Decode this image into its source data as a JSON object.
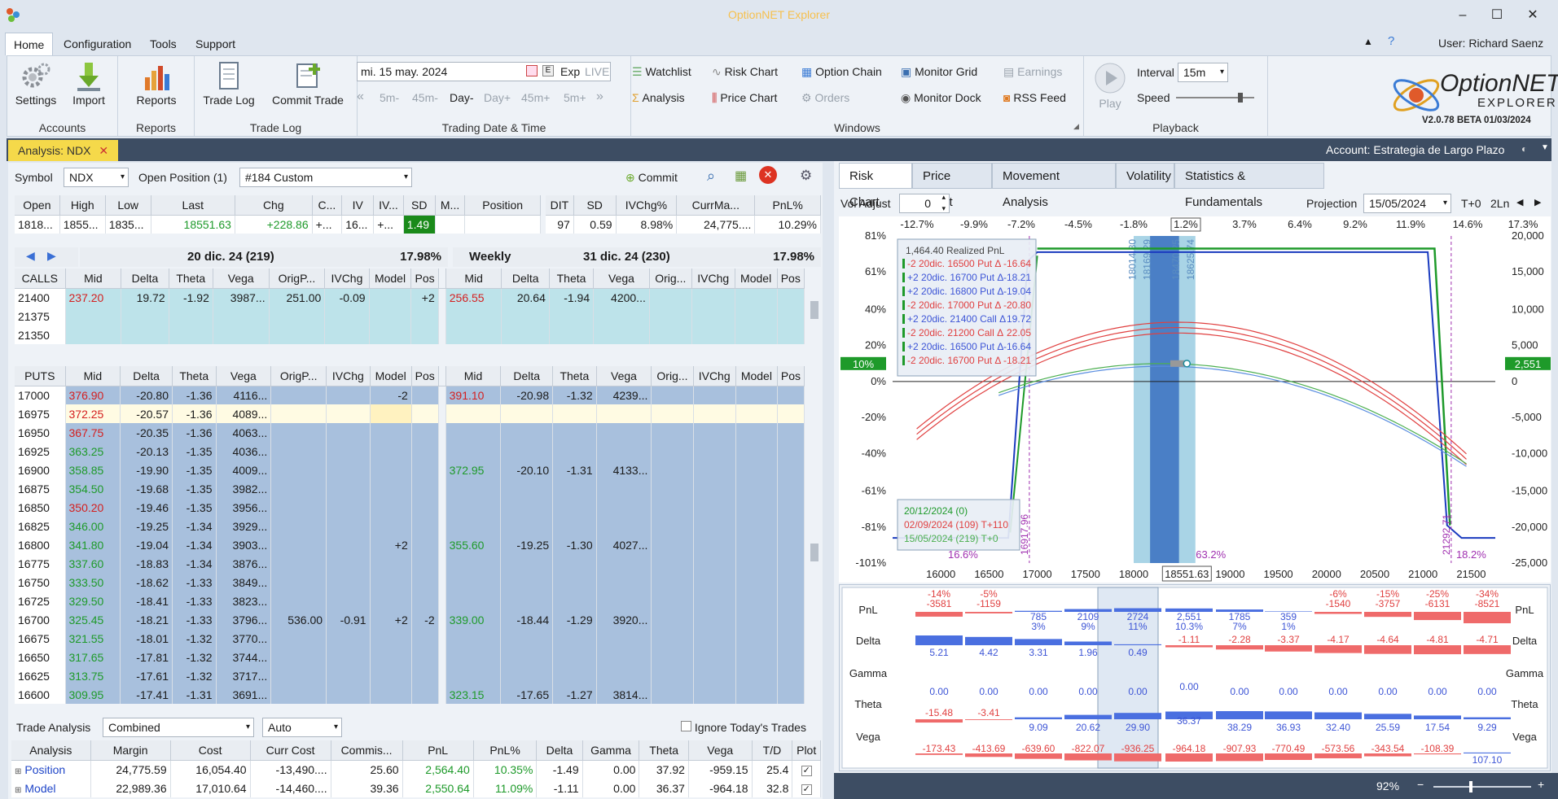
{
  "app": {
    "title": "OptionNET Explorer",
    "user": "User: Richard Saenz",
    "version": "V2.0.78 BETA 01/03/2024",
    "logo_text": "OptionNET",
    "logo_sub": "EXPLORER"
  },
  "menu": [
    "Home",
    "Configuration",
    "Tools",
    "Support"
  ],
  "ribbon": {
    "accounts": {
      "label": "Accounts",
      "settings": "Settings",
      "import": "Import"
    },
    "reports": {
      "label": "Reports",
      "reports": "Reports"
    },
    "tradelog": {
      "label": "Trade Log",
      "tradelog": "Trade Log",
      "commit": "Commit Trade"
    },
    "tradingdate": {
      "label": "Trading Date & Time",
      "date": "mi. 15 may. 2024",
      "exp": "Exp",
      "live": "LIVE",
      "steps": [
        "5m-",
        "45m-",
        "Day-",
        "Day+",
        "45m+",
        "5m+"
      ]
    },
    "windows": {
      "label": "Windows",
      "items": [
        "Watchlist",
        "Risk Chart",
        "Option Chain",
        "Monitor Grid",
        "Earnings",
        "Analysis",
        "Price Chart",
        "Orders",
        "Monitor Dock",
        "RSS Feed"
      ]
    },
    "playback": {
      "label": "Playback",
      "play": "Play",
      "interval_label": "Interval",
      "interval": "15m",
      "speed_label": "Speed"
    }
  },
  "tabs": {
    "analysis": "Analysis: NDX",
    "account": "Account: Estrategia de Largo Plazo"
  },
  "symbol_bar": {
    "symbol_label": "Symbol",
    "symbol": "NDX",
    "open_pos_label": "Open Position (1)",
    "position": "#184 Custom",
    "commit": "Commit"
  },
  "quote": {
    "headers": [
      "Open",
      "High",
      "Low",
      "Last",
      "Chg",
      "C...",
      "IV",
      "IV...",
      "SD",
      "M...",
      "Position"
    ],
    "values": [
      "1818...",
      "1855...",
      "1835...",
      "18551.63",
      "+228.86",
      "+...",
      "16...",
      "+...",
      "1.49",
      "",
      ""
    ],
    "headers2": [
      "DIT",
      "SD",
      "IVChg%",
      "CurrMa...",
      "PnL%"
    ],
    "values2": [
      "97",
      "0.59",
      "8.98%",
      "24,775....",
      "10.29%"
    ]
  },
  "chain": {
    "exp1": {
      "date": "20 dic. 24 (219)",
      "iv": "17.98%"
    },
    "exp2": {
      "name": "Weekly",
      "date": "31 dic. 24 (230)",
      "iv": "17.98%"
    },
    "cols1": [
      "Mid",
      "Delta",
      "Theta",
      "Vega",
      "OrigP...",
      "IVChg",
      "Model",
      "Pos"
    ],
    "cols2": [
      "Mid",
      "Delta",
      "Theta",
      "Vega",
      "Orig...",
      "IVChg",
      "Model",
      "Pos"
    ],
    "calls_label": "CALLS",
    "calls": [
      {
        "strike": "21400",
        "mid": "237.20",
        "delta": "19.72",
        "theta": "-1.92",
        "vega": "3987...",
        "orig": "251.00",
        "ivchg": "-0.09",
        "model": "",
        "pos": "+2",
        "mid2": "256.55",
        "delta2": "20.64",
        "theta2": "-1.94",
        "vega2": "4200..."
      },
      {
        "strike": "21375"
      },
      {
        "strike": "21350"
      }
    ],
    "puts_label": "PUTS",
    "puts": [
      {
        "strike": "17000",
        "mid": "376.90",
        "delta": "-20.80",
        "theta": "-1.36",
        "vega": "4116...",
        "model": "-2",
        "mid2": "391.10",
        "delta2": "-20.98",
        "theta2": "-1.32",
        "vega2": "4239..."
      },
      {
        "strike": "16975",
        "mid": "372.25",
        "delta": "-20.57",
        "theta": "-1.36",
        "vega": "4089..."
      },
      {
        "strike": "16950",
        "mid": "367.75",
        "delta": "-20.35",
        "theta": "-1.36",
        "vega": "4063..."
      },
      {
        "strike": "16925",
        "mid": "363.25",
        "delta": "-20.13",
        "theta": "-1.35",
        "vega": "4036..."
      },
      {
        "strike": "16900",
        "mid": "358.85",
        "delta": "-19.90",
        "theta": "-1.35",
        "vega": "4009...",
        "mid2": "372.95",
        "delta2": "-20.10",
        "theta2": "-1.31",
        "vega2": "4133..."
      },
      {
        "strike": "16875",
        "mid": "354.50",
        "delta": "-19.68",
        "theta": "-1.35",
        "vega": "3982..."
      },
      {
        "strike": "16850",
        "mid": "350.20",
        "delta": "-19.46",
        "theta": "-1.35",
        "vega": "3956..."
      },
      {
        "strike": "16825",
        "mid": "346.00",
        "delta": "-19.25",
        "theta": "-1.34",
        "vega": "3929..."
      },
      {
        "strike": "16800",
        "mid": "341.80",
        "delta": "-19.04",
        "theta": "-1.34",
        "vega": "3903...",
        "model": "+2",
        "mid2": "355.60",
        "delta2": "-19.25",
        "theta2": "-1.30",
        "vega2": "4027..."
      },
      {
        "strike": "16775",
        "mid": "337.60",
        "delta": "-18.83",
        "theta": "-1.34",
        "vega": "3876..."
      },
      {
        "strike": "16750",
        "mid": "333.50",
        "delta": "-18.62",
        "theta": "-1.33",
        "vega": "3849..."
      },
      {
        "strike": "16725",
        "mid": "329.50",
        "delta": "-18.41",
        "theta": "-1.33",
        "vega": "3823..."
      },
      {
        "strike": "16700",
        "mid": "325.45",
        "delta": "-18.21",
        "theta": "-1.33",
        "vega": "3796...",
        "orig": "536.00",
        "ivchg": "-0.91",
        "model": "+2",
        "pos": "-2",
        "mid2": "339.00",
        "delta2": "-18.44",
        "theta2": "-1.29",
        "vega2": "3920..."
      },
      {
        "strike": "16675",
        "mid": "321.55",
        "delta": "-18.01",
        "theta": "-1.32",
        "vega": "3770..."
      },
      {
        "strike": "16650",
        "mid": "317.65",
        "delta": "-17.81",
        "theta": "-1.32",
        "vega": "3744..."
      },
      {
        "strike": "16625",
        "mid": "313.75",
        "delta": "-17.61",
        "theta": "-1.32",
        "vega": "3717..."
      },
      {
        "strike": "16600",
        "mid": "309.95",
        "delta": "-17.41",
        "theta": "-1.31",
        "vega": "3691...",
        "mid2": "323.15",
        "delta2": "-17.65",
        "theta2": "-1.27",
        "vega2": "3814..."
      }
    ]
  },
  "trade_analysis": {
    "label": "Trade Analysis",
    "mode": "Combined",
    "auto": "Auto",
    "ignore": "Ignore Today's Trades",
    "headers": [
      "Analysis",
      "Margin",
      "Cost",
      "Curr Cost",
      "Commis...",
      "PnL",
      "PnL%",
      "Delta",
      "Gamma",
      "Theta",
      "Vega",
      "T/D",
      "Plot"
    ],
    "rows": [
      [
        "Position",
        "24,775.59",
        "16,054.40",
        "-13,490....",
        "25.60",
        "2,564.40",
        "10.35%",
        "-1.49",
        "0.00",
        "37.92",
        "-959.15",
        "25.4",
        "✓"
      ],
      [
        "Model",
        "22,989.36",
        "17,010.64",
        "-14,460....",
        "39.36",
        "2,550.64",
        "11.09%",
        "-1.11",
        "0.00",
        "36.37",
        "-964.18",
        "32.8",
        "✓"
      ]
    ]
  },
  "right_tabs": [
    "Risk Chart",
    "Price Chart",
    "Movement Analysis",
    "Volatility",
    "Statistics & Fundamentals"
  ],
  "risk_bar": {
    "vol_label": "Vol Adjust",
    "vol": "0",
    "proj_label": "Projection",
    "proj_date": "15/05/2024",
    "t0": "T+0",
    "ln": "2Ln"
  },
  "chart_data": {
    "type": "line",
    "top_pct": [
      "-12.7%",
      "-9.9%",
      "-7.2%",
      "-4.5%",
      "-1.8%",
      "1.2%",
      "3.7%",
      "6.4%",
      "9.2%",
      "11.9%",
      "14.6%",
      "17.3%"
    ],
    "x": [
      "16000",
      "16500",
      "17000",
      "17500",
      "18000",
      "18551.63",
      "19000",
      "19500",
      "20000",
      "20500",
      "21000",
      "21500"
    ],
    "y_left": [
      "81%",
      "61%",
      "40%",
      "20%",
      "0%",
      "-20%",
      "-40%",
      "-61%",
      "-81%",
      "-101%"
    ],
    "y_right": [
      "20,000",
      "15,000",
      "10,000",
      "5,000",
      "0",
      "-5,000",
      "-10,000",
      "-15,000",
      "-20,000",
      "-25,000"
    ],
    "badge_left": "10%",
    "badge_right": "2,551",
    "band_labels": [
      "18014.80",
      "18169.29",
      "18470.25",
      "18625.74"
    ],
    "vlabels": [
      "16917.96",
      "21292.71"
    ],
    "bottom_pcts": [
      "16.6%",
      "63.2%",
      "18.2%"
    ],
    "legend": {
      "title": "1,464.40 Realized PnL",
      "items": [
        {
          "text": "-2 20dic. 16500 Put Δ",
          "val": "-16.64",
          "color": "#e04040"
        },
        {
          "text": "+2 20dic. 16700 Put Δ",
          "val": "-18.21",
          "color": "#3d55d6"
        },
        {
          "text": "+2 20dic. 16800 Put Δ",
          "val": "-19.04",
          "color": "#3d55d6"
        },
        {
          "text": "-2 20dic. 17000 Put Δ",
          "val": "-20.80",
          "color": "#e04040"
        },
        {
          "text": "+2 20dic. 21400 Call Δ",
          "val": "19.72",
          "color": "#3d55d6"
        },
        {
          "text": "-2 20dic. 21200 Call Δ",
          "val": "22.05",
          "color": "#e04040"
        },
        {
          "text": "+2 20dic. 16500 Put Δ",
          "val": "-16.64",
          "color": "#3d55d6"
        },
        {
          "text": "-2 20dic. 16700 Put Δ",
          "val": "-18.21",
          "color": "#e04040"
        }
      ]
    },
    "legend2": [
      {
        "text": "20/12/2024 (0)",
        "color": "#1e9a2a"
      },
      {
        "text": "02/09/2024 (109) T+110",
        "color": "#e04040"
      },
      {
        "text": "15/05/2024 (219) T+0",
        "color": "#4caf50"
      }
    ],
    "series": [
      {
        "name": "20/12/2024 (0)",
        "color": "#1e9a2a"
      },
      {
        "name": "02/09/2024 (109) T+110",
        "color": "#e04040"
      },
      {
        "name": "15/05/2024 (219) T+0",
        "color": "#4caf50"
      }
    ]
  },
  "greeks": {
    "rows": [
      "PnL",
      "Delta",
      "Gamma",
      "Theta",
      "Vega"
    ],
    "pnl": [
      [
        "-14%",
        "-3581"
      ],
      [
        "-5%",
        "-1159"
      ],
      [
        "785",
        "3%"
      ],
      [
        "2109",
        "9%"
      ],
      [
        "2724",
        "11%"
      ],
      [
        "2,551",
        "10.3%"
      ],
      [
        "1785",
        "7%"
      ],
      [
        "359",
        "1%"
      ],
      [
        "-6%",
        "-1540"
      ],
      [
        "-15%",
        "-3757"
      ],
      [
        "-25%",
        "-6131"
      ],
      [
        "-34%",
        "-8521"
      ]
    ],
    "delta": [
      "5.21",
      "4.42",
      "3.31",
      "1.96",
      "0.49",
      "-1.11",
      "-2.28",
      "-3.37",
      "-4.17",
      "-4.64",
      "-4.81",
      "-4.71"
    ],
    "gamma": [
      "0.00",
      "0.00",
      "0.00",
      "0.00",
      "0.00",
      "0.00",
      "0.00",
      "0.00",
      "0.00",
      "0.00",
      "0.00",
      "0.00"
    ],
    "theta": [
      "-15.48",
      "-3.41",
      "9.09",
      "20.62",
      "29.90",
      "36.37",
      "38.29",
      "36.93",
      "32.40",
      "25.59",
      "17.54",
      "9.29"
    ],
    "vega": [
      "-173.43",
      "-413.69",
      "-639.60",
      "-822.07",
      "-936.25",
      "-964.18",
      "-907.93",
      "-770.49",
      "-573.56",
      "-343.54",
      "-108.39",
      "107.10"
    ]
  },
  "status": {
    "zoom": "92%"
  }
}
